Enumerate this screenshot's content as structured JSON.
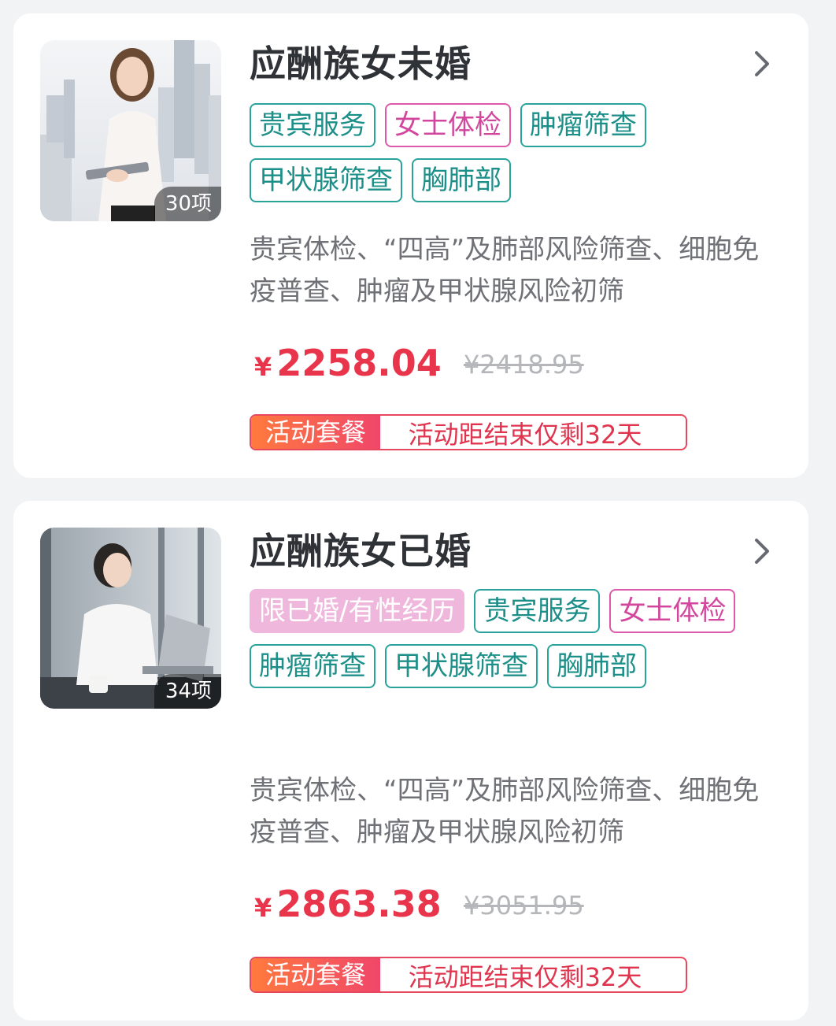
{
  "packages": [
    {
      "title": "应酬族女未婚",
      "item_count": "30项",
      "tags": [
        {
          "label": "贵宾服务",
          "style": "teal"
        },
        {
          "label": "女士体检",
          "style": "pink"
        },
        {
          "label": "肿瘤筛查",
          "style": "teal"
        },
        {
          "label": "甲状腺筛查",
          "style": "teal"
        },
        {
          "label": "胸肺部",
          "style": "teal"
        }
      ],
      "description": "贵宾体检、“四高”及肺部风险筛查、细胞免疫普查、肿瘤及甲状腺风险初筛",
      "price_symbol": "¥",
      "price": "2258.04",
      "original_price": "¥2418.95",
      "promo_label": "活动套餐",
      "promo_text": "活动距结束仅剩32天"
    },
    {
      "title": "应酬族女已婚",
      "item_count": "34项",
      "tags": [
        {
          "label": "限已婚/有性经历",
          "style": "filled-pink"
        },
        {
          "label": "贵宾服务",
          "style": "teal"
        },
        {
          "label": "女士体检",
          "style": "pink"
        },
        {
          "label": "肿瘤筛查",
          "style": "teal"
        },
        {
          "label": "甲状腺筛查",
          "style": "teal"
        },
        {
          "label": "胸肺部",
          "style": "teal"
        }
      ],
      "description": "贵宾体检、“四高”及肺部风险筛查、细胞免疫普查、肿瘤及甲状腺风险初筛",
      "price_symbol": "¥",
      "price": "2863.38",
      "original_price": "¥3051.95",
      "promo_label": "活动套餐",
      "promo_text": "活动距结束仅剩32天"
    }
  ],
  "colors": {
    "teal": "#2aa39c",
    "pink": "#dc5aa9",
    "price_red": "#e8354c",
    "promo_gradient_start": "#ff7a3d",
    "promo_gradient_end": "#f0466a"
  },
  "icons": {
    "chevron": "chevron-right-icon"
  }
}
